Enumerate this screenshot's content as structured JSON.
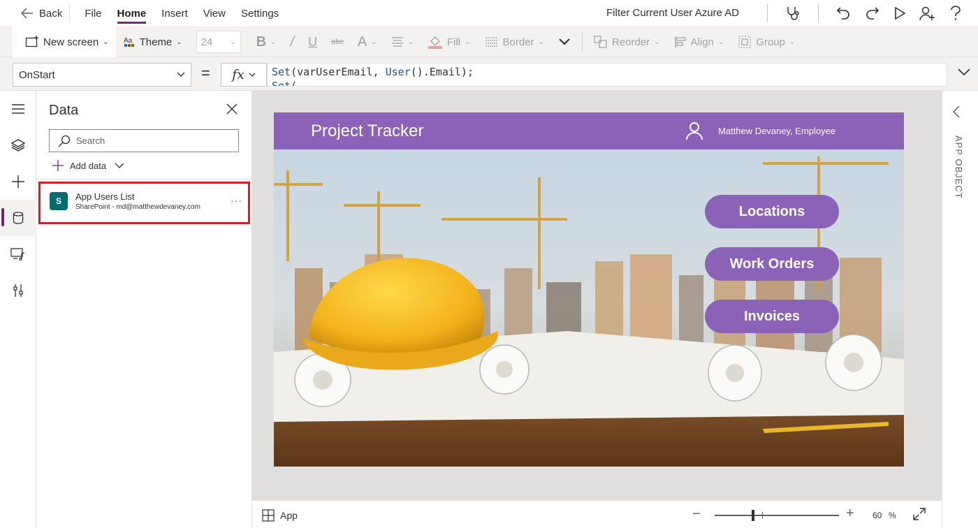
{
  "menubar": {
    "back_label": "Back",
    "tabs": [
      {
        "label": "File"
      },
      {
        "label": "Home",
        "active": true
      },
      {
        "label": "Insert"
      },
      {
        "label": "View"
      },
      {
        "label": "Settings"
      }
    ],
    "app_name": "Filter Current User Azure AD",
    "icons": [
      "stethoscope-icon",
      "undo-icon",
      "redo-icon",
      "play-icon",
      "add-user-icon",
      "help-icon"
    ]
  },
  "ribbon": {
    "new_screen": "New screen",
    "theme": "Theme",
    "font_size": "24",
    "fill": "Fill",
    "border": "Border",
    "reorder": "Reorder",
    "align": "Align",
    "group": "Group"
  },
  "formula_bar": {
    "property": "OnStart",
    "equals": "=",
    "fx": "fx",
    "line1_fn": "Set",
    "line1_args": "(varUserEmail, ",
    "line1_fn2": "User",
    "line1_rest": "().Email);",
    "line2": "Set("
  },
  "data_panel": {
    "title": "Data",
    "search_placeholder": "Search",
    "add_data": "Add data",
    "source": {
      "name": "App Users List",
      "subtitle": "SharePoint - md@matthewdevaney.com",
      "icon_letter": "S",
      "more": "···"
    }
  },
  "app": {
    "title": "Project Tracker",
    "user": "Matthew Devaney, Employee",
    "buttons": [
      "Locations",
      "Work Orders",
      "Invoices"
    ],
    "header_color": "#8a63b8"
  },
  "right_pane": {
    "label": "APP OBJECT"
  },
  "status_bar": {
    "app_label": "App",
    "zoom_value": "60",
    "zoom_unit": "%"
  },
  "colors": {
    "accent": "#742774",
    "highlight_border": "#d12128",
    "sharepoint": "#036c70"
  }
}
